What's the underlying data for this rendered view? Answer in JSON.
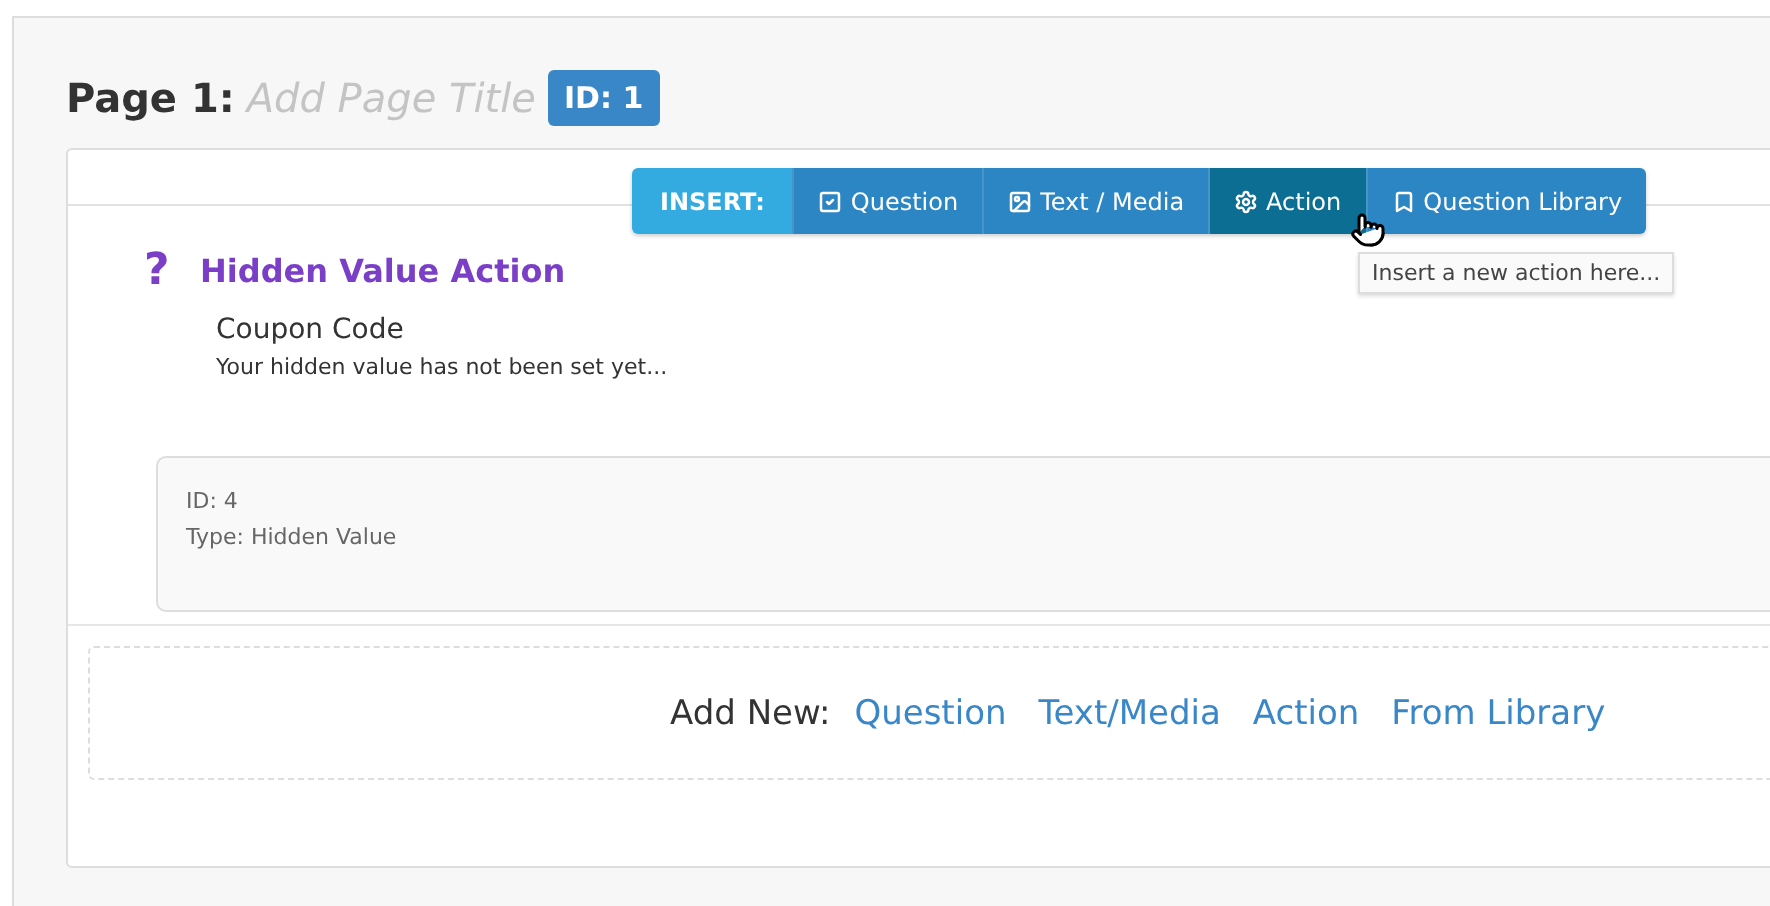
{
  "page": {
    "label": "Page 1:",
    "title_placeholder": "Add Page Title",
    "id_badge": "ID: 1"
  },
  "insert_toolbar": {
    "label": "INSERT:",
    "buttons": [
      {
        "label": "Question",
        "kind": "question",
        "selected": false
      },
      {
        "label": "Text / Media",
        "kind": "media",
        "selected": false
      },
      {
        "label": "Action",
        "kind": "action",
        "selected": true
      },
      {
        "label": "Question Library",
        "kind": "library",
        "selected": false
      }
    ]
  },
  "tooltip": "Insert a new action here...",
  "item": {
    "icon": "?",
    "title": "Hidden Value Action",
    "subtitle": "Coupon Code",
    "description": "Your hidden value has not been set yet...",
    "details": [
      "ID: 4",
      "Type: Hidden Value"
    ]
  },
  "add_new": {
    "label": "Add New:",
    "links": [
      "Question",
      "Text/Media",
      "Action",
      "From Library"
    ]
  }
}
